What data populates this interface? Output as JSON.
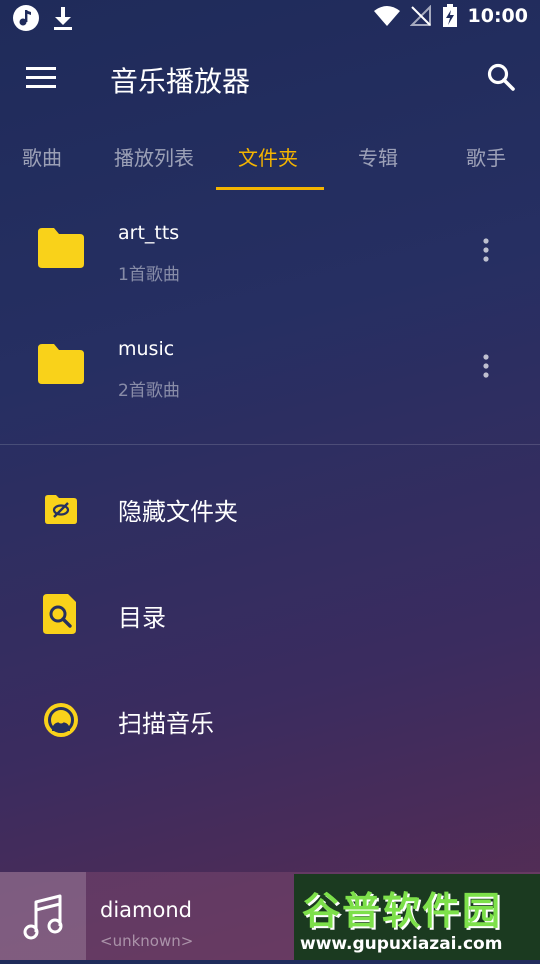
{
  "status_bar": {
    "time": "10:00"
  },
  "app_bar": {
    "title": "音乐播放器"
  },
  "tabs": [
    {
      "label": "歌曲"
    },
    {
      "label": "播放列表"
    },
    {
      "label": "文件夹"
    },
    {
      "label": "专辑"
    },
    {
      "label": "歌手"
    }
  ],
  "active_tab": "文件夹",
  "folders": [
    {
      "name": "art_tts",
      "count": "1首歌曲"
    },
    {
      "name": "music",
      "count": "2首歌曲"
    }
  ],
  "actions": [
    {
      "label": "隐藏文件夹",
      "icon": "hidden-folder-icon"
    },
    {
      "label": "目录",
      "icon": "directory-search-icon"
    },
    {
      "label": "扫描音乐",
      "icon": "scan-music-icon"
    }
  ],
  "player": {
    "title": "diamond",
    "artist": "<unknown>"
  },
  "watermark": {
    "main": "谷普软件园",
    "url": "www.gupuxiazai.com"
  },
  "colors": {
    "accent": "#f4b400",
    "folder": "#f9d21a"
  }
}
